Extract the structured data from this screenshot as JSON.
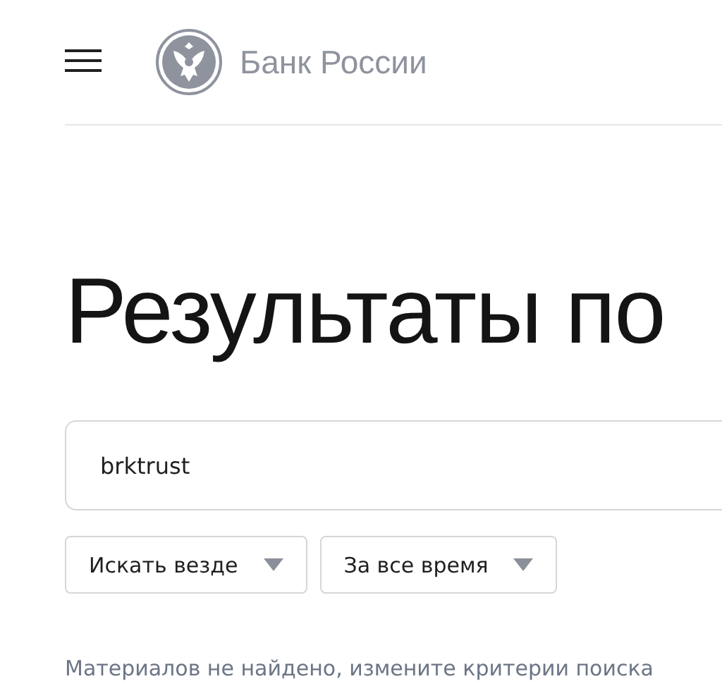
{
  "header": {
    "bank_name": "Банк России"
  },
  "title": "Результаты по",
  "search": {
    "value": "brktrust"
  },
  "filters": [
    {
      "label": "Искать везде"
    },
    {
      "label": "За все время"
    }
  ],
  "message": "Материалов не найдено, измените критерии поиска"
}
